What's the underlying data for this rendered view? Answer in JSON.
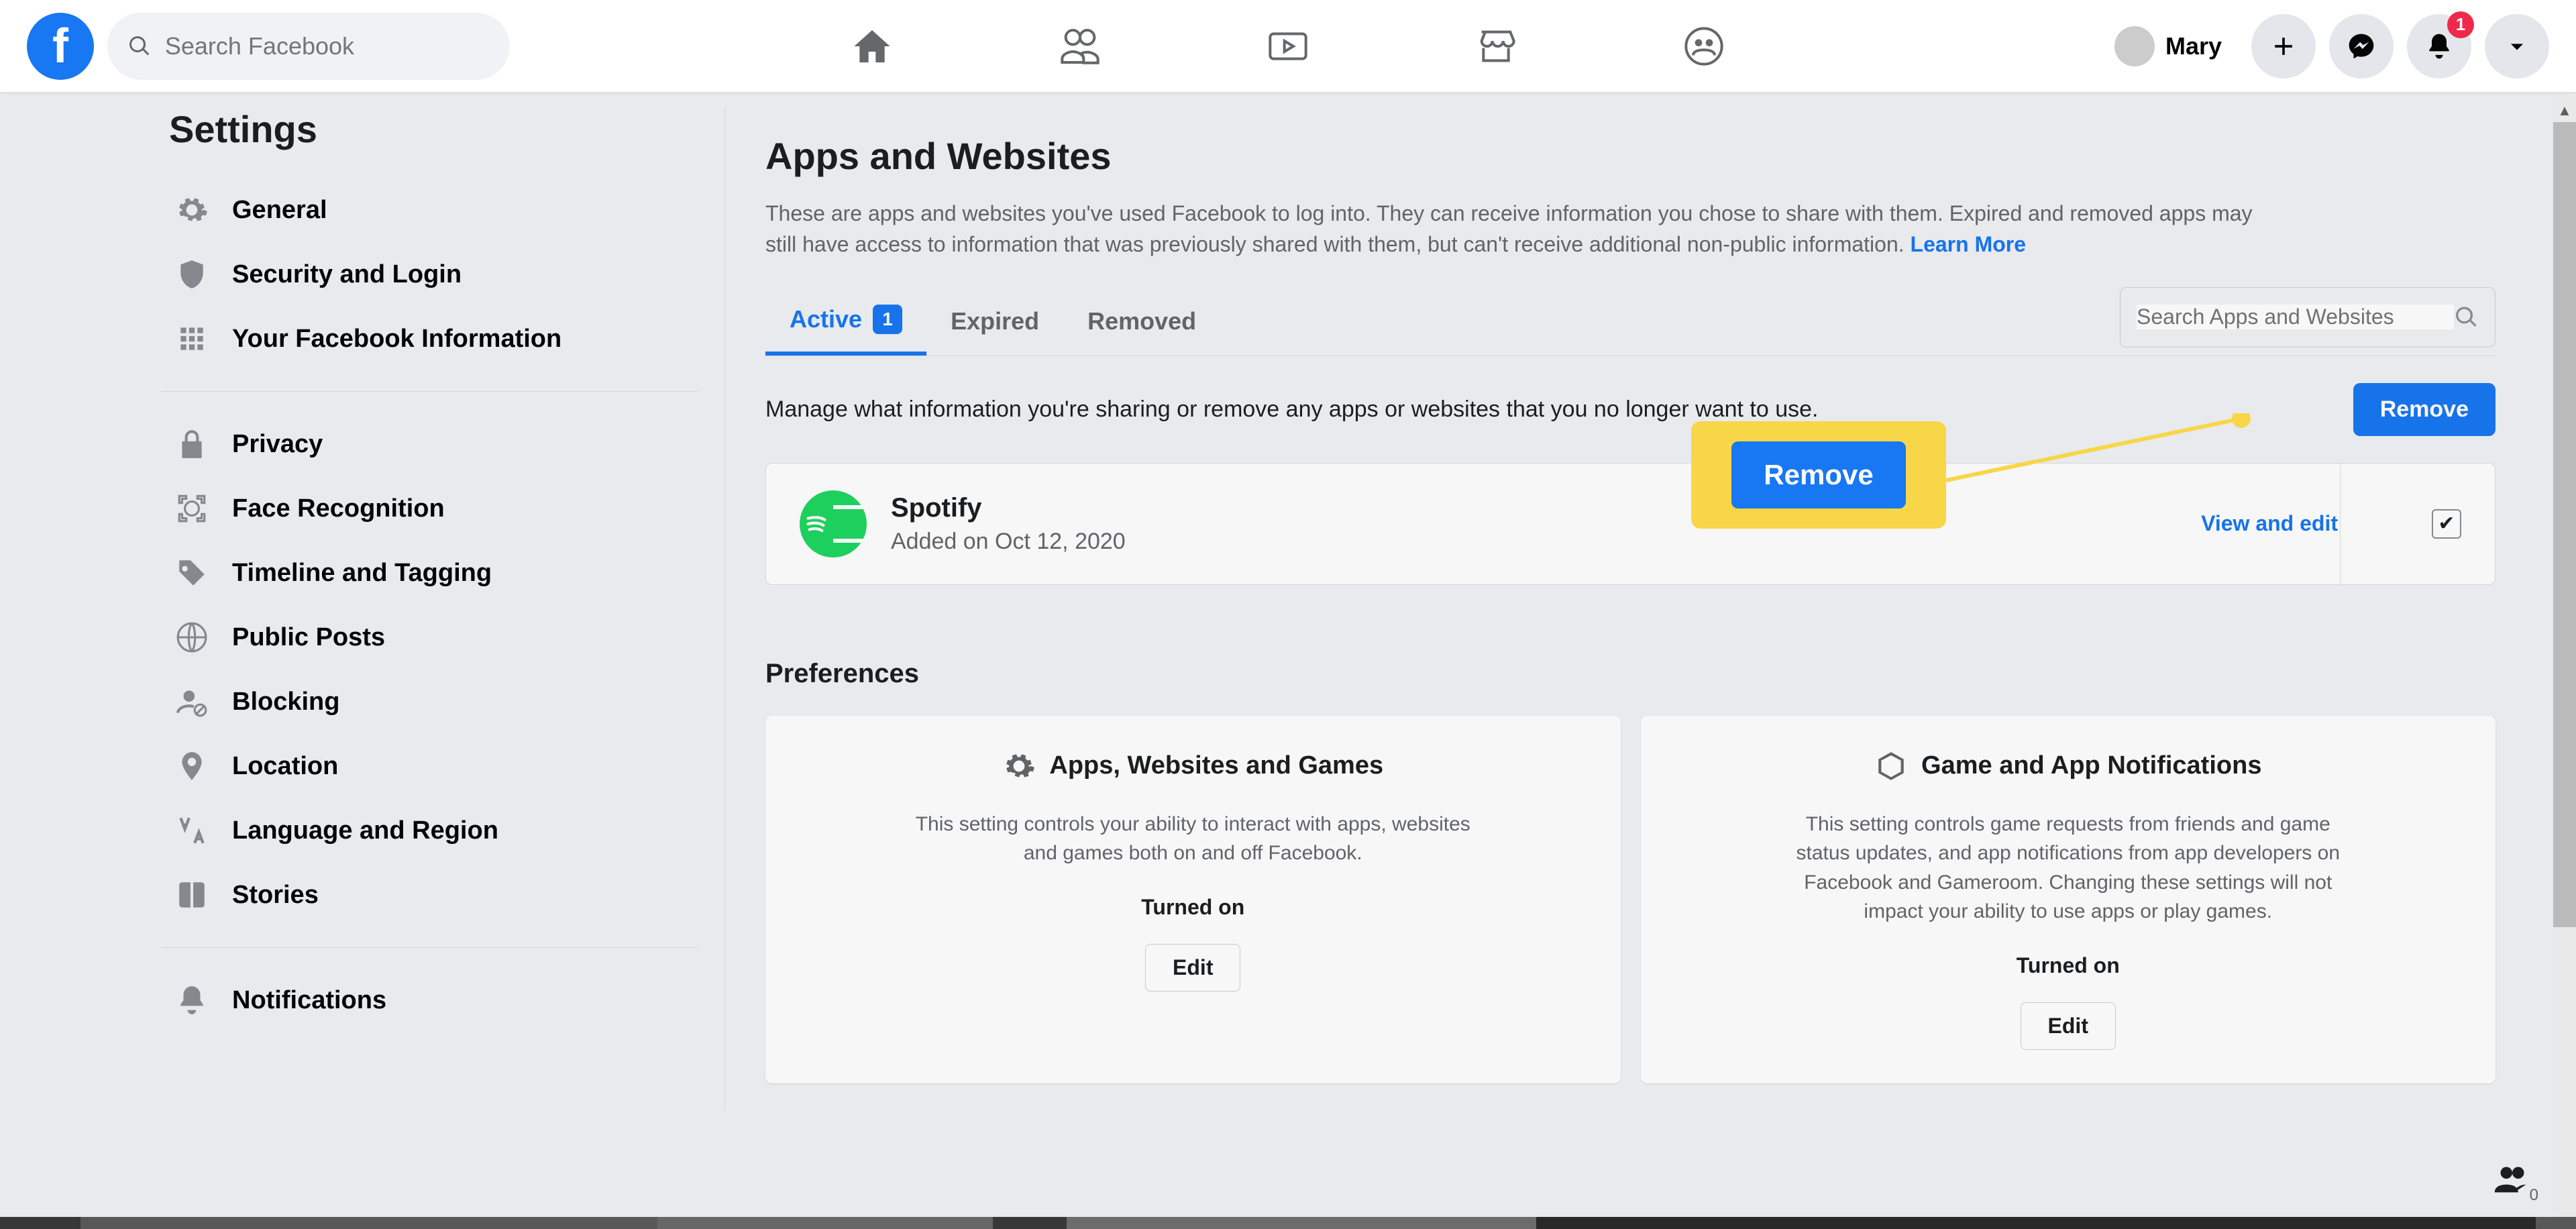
{
  "header": {
    "search_placeholder": "Search Facebook",
    "profile_name": "Mary",
    "notification_badge": "1"
  },
  "sidebar": {
    "title": "Settings",
    "items_group1": [
      {
        "label": "General"
      },
      {
        "label": "Security and Login"
      },
      {
        "label": "Your Facebook Information"
      }
    ],
    "items_group2": [
      {
        "label": "Privacy"
      },
      {
        "label": "Face Recognition"
      },
      {
        "label": "Timeline and Tagging"
      },
      {
        "label": "Public Posts"
      },
      {
        "label": "Blocking"
      },
      {
        "label": "Location"
      },
      {
        "label": "Language and Region"
      },
      {
        "label": "Stories"
      }
    ],
    "items_group3": [
      {
        "label": "Notifications"
      }
    ]
  },
  "main": {
    "title": "Apps and Websites",
    "description": "These are apps and websites you've used Facebook to log into. They can receive information you chose to share with them. Expired and removed apps may still have access to information that was previously shared with them, but can't receive additional non-public information. ",
    "learn_more": "Learn More",
    "tabs": {
      "active": {
        "label": "Active",
        "count": "1"
      },
      "expired": {
        "label": "Expired"
      },
      "removed": {
        "label": "Removed"
      }
    },
    "tab_search_placeholder": "Search Apps and Websites",
    "manage_text": "Manage what information you're sharing or remove any apps or websites that you no longer want to use.",
    "remove_btn": "Remove",
    "callout_remove": "Remove",
    "app": {
      "name": "Spotify",
      "added": "Added on Oct 12, 2020",
      "view_edit": "View and edit"
    },
    "preferences_title": "Preferences",
    "card1": {
      "title": "Apps, Websites and Games",
      "desc": "This setting controls your ability to interact with apps, websites and games both on and off Facebook.",
      "status": "Turned on",
      "edit": "Edit"
    },
    "card2": {
      "title": "Game and App Notifications",
      "desc": "This setting controls game requests from friends and game status updates, and app notifications from app developers on Facebook and Gameroom. Changing these settings will not impact your ability to use apps or play games.",
      "status": "Turned on",
      "edit": "Edit"
    }
  },
  "groups_count": "0"
}
